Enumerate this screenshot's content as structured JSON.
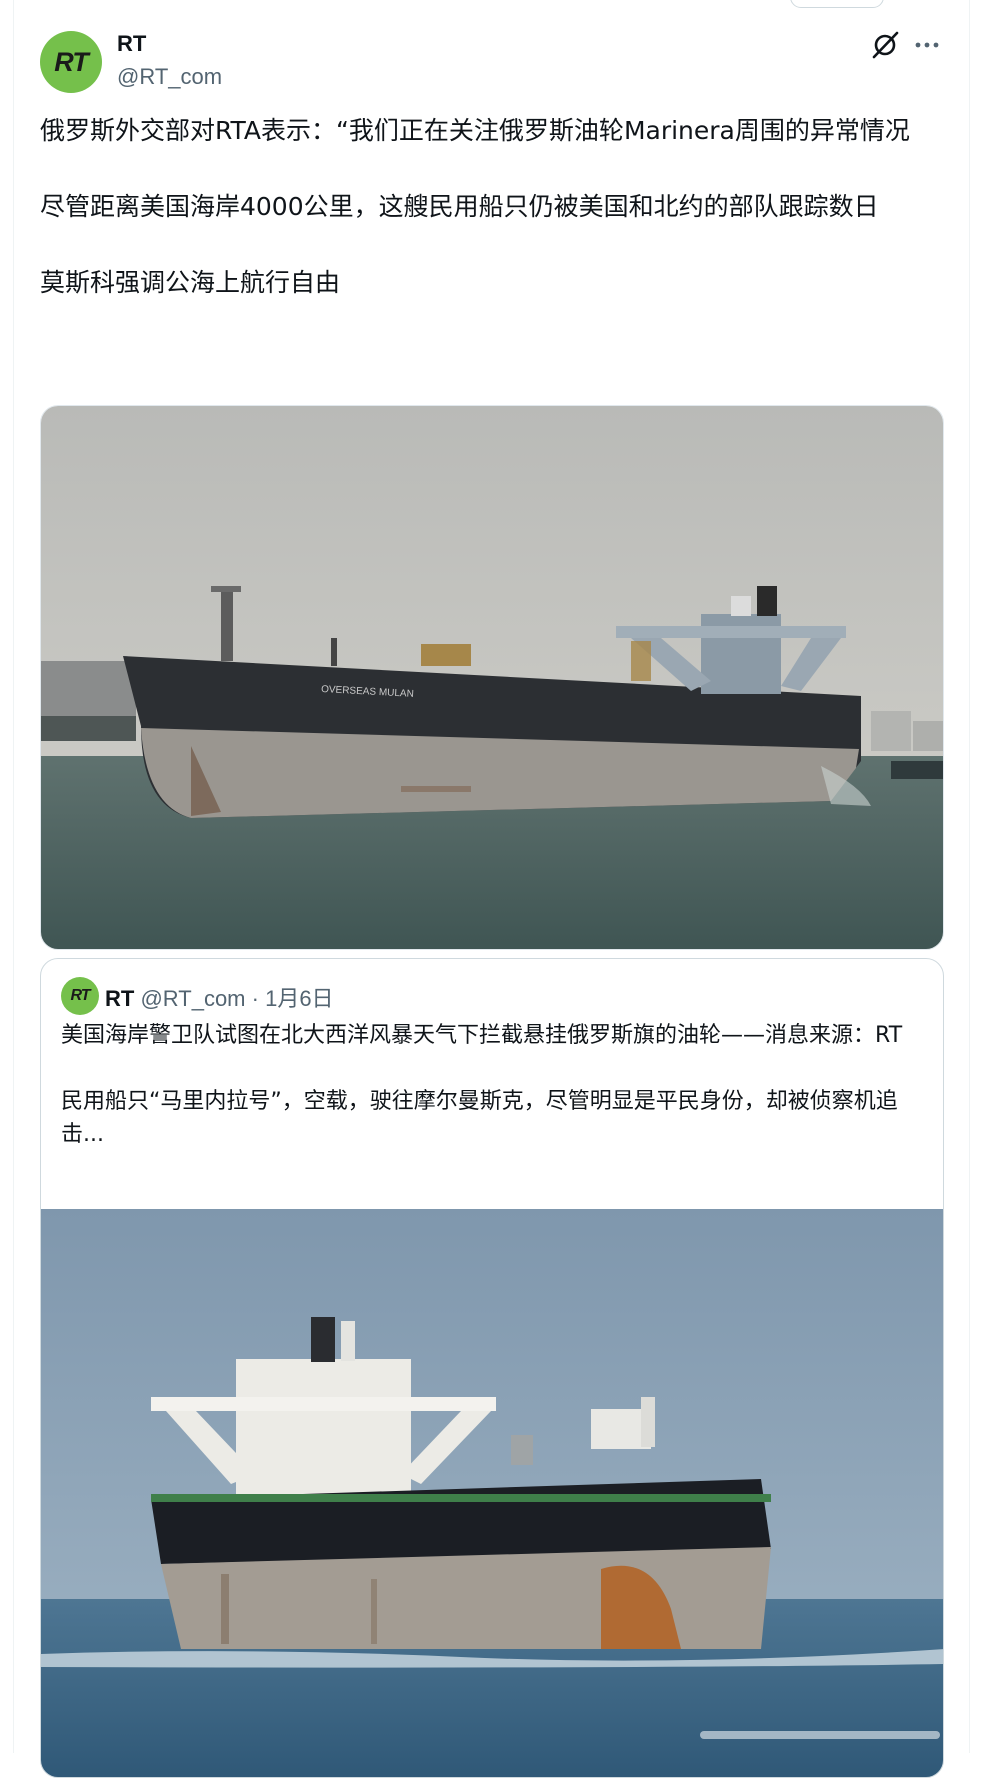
{
  "author": {
    "name": "RT",
    "handle": "@RT_com",
    "avatar_text": "RT",
    "avatar_color": "#75c04b"
  },
  "icons": {
    "grok": "grok-slash-icon",
    "more": "more-horizontal-icon"
  },
  "tweet": {
    "text": "俄罗斯外交部对RTA表示：“我们正在关注俄罗斯油轮Marinera周围的异常情况\n\n尽管距离美国海岸4000公里，这艘民用船只仍被美国和北约的部队跟踪数日\n\n莫斯科强调公海上航行自由",
    "ship_name_on_hull": "OVERSEAS MULAN"
  },
  "quote": {
    "avatar_text": "RT",
    "name": "RT",
    "handle": "@RT_com",
    "separator": " · ",
    "date": "1月6日",
    "text": "美国海岸警卫队试图在北大西洋风暴天气下拦截悬挂俄罗斯旗的油轮——消息来源：RT\n\n民用船只“马里内拉号”，空载，驶往摩尔曼斯克，尽管明显是平民身份，却被侦察机追击..."
  }
}
